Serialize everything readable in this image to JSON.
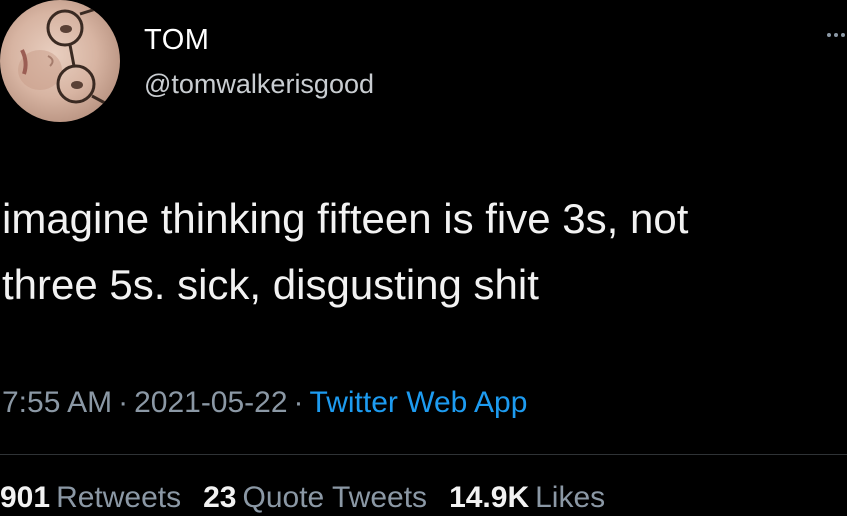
{
  "user": {
    "display_name": "TOM",
    "handle": "@tomwalkerisgood"
  },
  "tweet": {
    "line1": "imagine thinking fifteen is five 3s, not",
    "line2": "three 5s. sick, disgusting shit"
  },
  "meta": {
    "time": "7:55 AM",
    "separator": "·",
    "date": "2021-05-22",
    "source": "Twitter Web App"
  },
  "stats": {
    "retweets_count": "901",
    "retweets_label": "Retweets",
    "quotes_count": "23",
    "quotes_label": "Quote Tweets",
    "likes_count": "14.9K",
    "likes_label": "Likes"
  },
  "colors": {
    "background": "#000000",
    "text": "#f2f2f2",
    "secondary": "#8b98a5",
    "link": "#1d9bf0"
  }
}
